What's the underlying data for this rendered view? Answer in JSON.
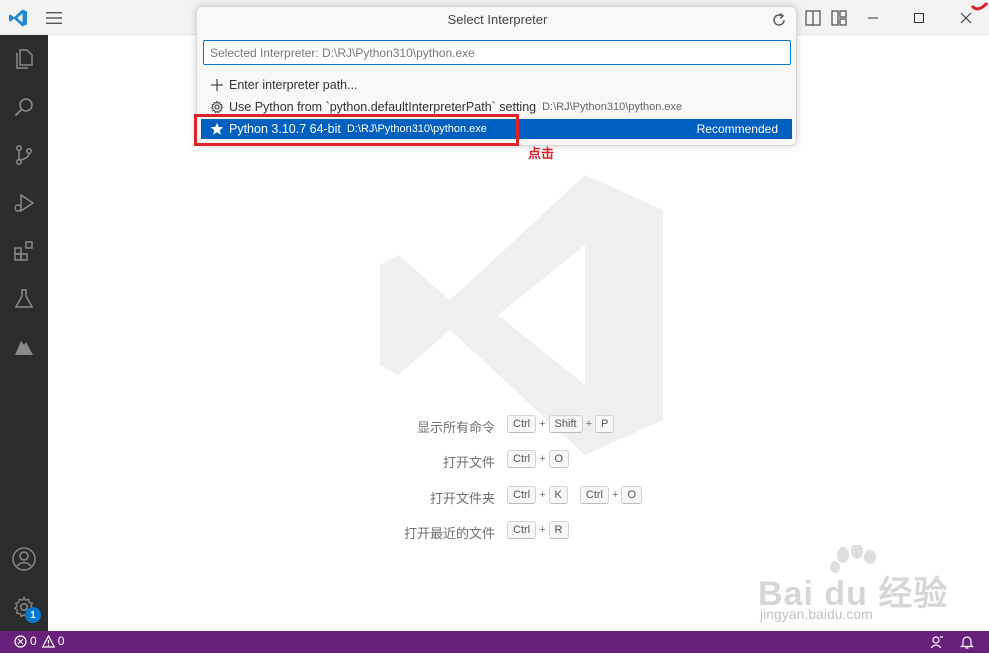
{
  "quickpick": {
    "title": "Select Interpreter",
    "input_value": "Selected Interpreter: D:\\RJ\\Python310\\python.exe",
    "items": [
      {
        "icon": "plus-icon",
        "label": "Enter interpreter path...",
        "description": ""
      },
      {
        "icon": "gear-icon",
        "label": "Use Python from `python.defaultInterpreterPath` setting",
        "description": "D:\\RJ\\Python310\\python.exe"
      },
      {
        "icon": "star-icon",
        "label": "Python 3.10.7 64-bit",
        "description": "D:\\RJ\\Python310\\python.exe",
        "badge": "Recommended",
        "selected": true
      }
    ]
  },
  "annotation": {
    "label": "点击"
  },
  "shortcuts": [
    {
      "label": "显示所有命令",
      "keys": [
        [
          "Ctrl",
          "Shift",
          "P"
        ]
      ]
    },
    {
      "label": "打开文件",
      "keys": [
        [
          "Ctrl",
          "O"
        ]
      ]
    },
    {
      "label": "打开文件夹",
      "keys": [
        [
          "Ctrl",
          "K"
        ],
        [
          "Ctrl",
          "O"
        ]
      ]
    },
    {
      "label": "打开最近的文件",
      "keys": [
        [
          "Ctrl",
          "R"
        ]
      ]
    }
  ],
  "statusbar": {
    "errors": "0",
    "warnings": "0"
  },
  "activitybar": {
    "settings_badge": "1"
  },
  "watermark": {
    "brand": "Bai du 经验",
    "url": "jingyan.baidu.com"
  },
  "colors": {
    "accent": "#0078d4",
    "selection": "#0060c0",
    "statusbar": "#68217a",
    "highlight": "#e0202a"
  }
}
